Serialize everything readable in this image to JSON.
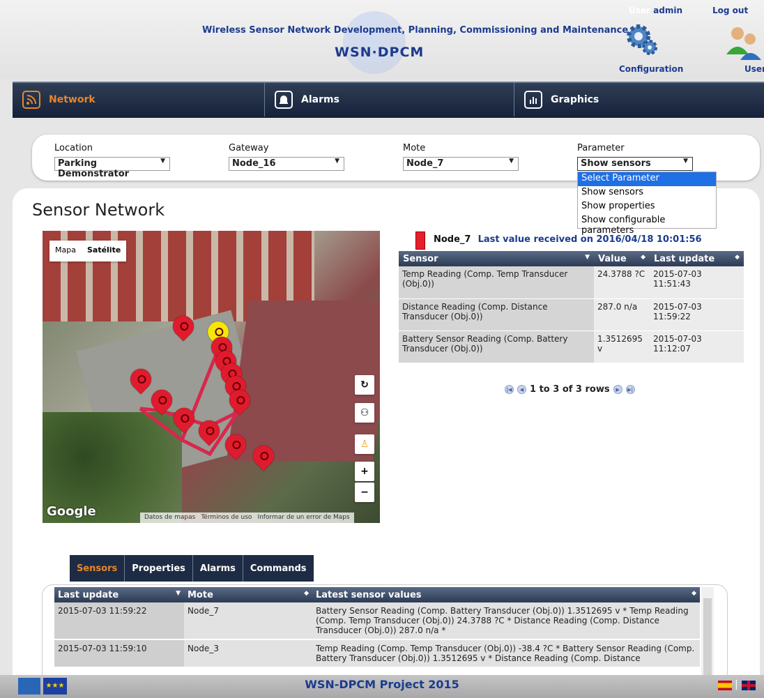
{
  "header": {
    "title": "Wireless Sensor Network Development, Planning, Commissioning and Maintenance",
    "logo": "WSN·DPCM",
    "user_label": "User",
    "user_name": "admin",
    "logout": "Log out",
    "configuration": "Configuration",
    "users": "User"
  },
  "nav": {
    "tabs": [
      {
        "label": "Network",
        "icon": "rss-icon"
      },
      {
        "label": "Alarms",
        "icon": "alarm-icon"
      },
      {
        "label": "Graphics",
        "icon": "bar-chart-icon"
      }
    ]
  },
  "filters": {
    "location": {
      "label": "Location",
      "value": "Parking Demonstrator"
    },
    "gateway": {
      "label": "Gateway",
      "value": "Node_16"
    },
    "mote": {
      "label": "Mote",
      "value": "Node_7"
    },
    "parameter": {
      "label": "Parameter",
      "value": "Show sensors",
      "options": [
        "Select Parameter",
        "Show sensors",
        "Show properties",
        "Show configurable parameters"
      ]
    }
  },
  "page_title": "Sensor Network",
  "map": {
    "toggle": [
      "Mapa",
      "Satélite"
    ],
    "google": "Google",
    "footer": [
      "Datos de mapas",
      "Términos de uso",
      "Informar de un error de Maps"
    ],
    "controls": [
      "↻",
      "⚇",
      "♙",
      "+",
      "−"
    ]
  },
  "node": {
    "name": "Node_7",
    "last_value": "Last value received on 2016/04/18 10:01:56",
    "columns": [
      "Sensor",
      "Value",
      "Last update"
    ],
    "rows": [
      {
        "sensor": "Temp Reading (Comp. Temp Transducer (Obj.0))",
        "value": "24.3788 ?C",
        "updated": "2015-07-03 11:51:43"
      },
      {
        "sensor": "Distance Reading (Comp. Distance Transducer (Obj.0))",
        "value": "287.0 n/a",
        "updated": "2015-07-03 11:59:22"
      },
      {
        "sensor": "Battery Sensor Reading (Comp. Battery Transducer (Obj.0))",
        "value": "1.3512695 v",
        "updated": "2015-07-03 11:12:07"
      }
    ],
    "pager": "1 to 3 of 3 rows"
  },
  "bottom_tabs": [
    "Sensors",
    "Properties",
    "Alarms",
    "Commands"
  ],
  "bottom_table": {
    "columns": [
      "Last update",
      "Mote",
      "Latest sensor values"
    ],
    "rows": [
      {
        "updated": "2015-07-03 11:59:22",
        "mote": "Node_7",
        "values": "Battery Sensor Reading (Comp. Battery Transducer (Obj.0)) 1.3512695 v * Temp Reading (Comp. Temp Transducer (Obj.0)) 24.3788 ?C * Distance Reading (Comp. Distance Transducer (Obj.0)) 287.0 n/a *"
      },
      {
        "updated": "2015-07-03 11:59:10",
        "mote": "Node_3",
        "values": "Temp Reading (Comp. Temp Transducer (Obj.0)) -38.4 ?C * Battery Sensor Reading (Comp. Battery Transducer (Obj.0)) 1.3512695 v * Distance Reading (Comp. Distance"
      }
    ]
  },
  "footer": {
    "text": "WSN-DPCM Project 2015",
    "separator": "|"
  },
  "colors": {
    "nav_bg": "#1e2b44",
    "active_tab": "#e8862a",
    "brand_blue": "#1b3b8f",
    "pin_red": "#e01b2e",
    "dropdown_highlight": "#1f6fe5"
  }
}
